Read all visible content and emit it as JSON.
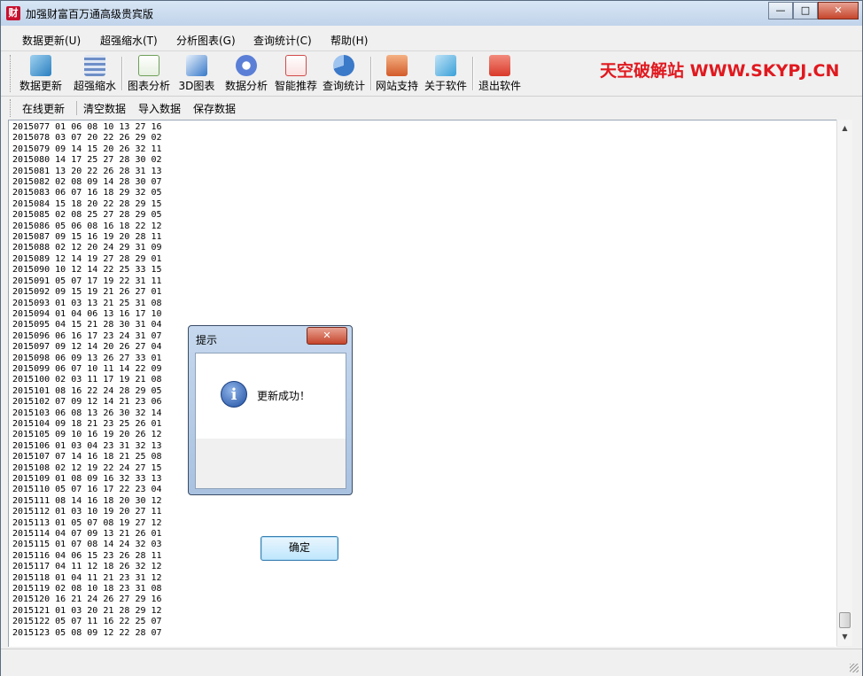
{
  "window": {
    "app_icon_text": "财",
    "title": "加强财富百万通高级贵宾版",
    "min_glyph": "—",
    "max_glyph": "□",
    "close_glyph": "✕"
  },
  "menu": [
    "数据更新(U)",
    "超强缩水(T)",
    "分析图表(G)",
    "查询统计(C)",
    "帮助(H)"
  ],
  "toolbar": [
    {
      "label": "数据更新",
      "icon": "computer-update-icon",
      "color": "#3aa0d8"
    },
    {
      "label": "超强缩水",
      "icon": "shrink-grid-icon",
      "color": "#6d8ec7"
    },
    {
      "label": "图表分析",
      "icon": "chart-doc-icon",
      "color": "#6f9f5a"
    },
    {
      "label": "3D图表",
      "icon": "3d-chart-icon",
      "color": "#3578c9"
    },
    {
      "label": "数据分析",
      "icon": "gear-analysis-icon",
      "color": "#5b7fd6"
    },
    {
      "label": "智能推荐",
      "icon": "recommend-doc-icon",
      "color": "#d24a4a"
    },
    {
      "label": "查询统计",
      "icon": "pie-query-icon",
      "color": "#3b79c9"
    },
    {
      "label": "网站支持",
      "icon": "home-web-icon",
      "color": "#d35b2a"
    },
    {
      "label": "关于软件",
      "icon": "about-computer-icon",
      "color": "#3aa0d8"
    },
    {
      "label": "退出软件",
      "icon": "power-exit-icon",
      "color": "#d93a2a"
    }
  ],
  "brand_text": "天空破解站 WWW.SKYPJ.CN",
  "toolbar2": [
    "在线更新",
    "清空数据",
    "导入数据",
    "保存数据"
  ],
  "rows": [
    "2015077 01 06 08 10 13 27 16",
    "2015078 03 07 20 22 26 29 02",
    "2015079 09 14 15 20 26 32 11",
    "2015080 14 17 25 27 28 30 02",
    "2015081 13 20 22 26 28 31 13",
    "2015082 02 08 09 14 28 30 07",
    "2015083 06 07 16 18 29 32 05",
    "2015084 15 18 20 22 28 29 15",
    "2015085 02 08 25 27 28 29 05",
    "2015086 05 06 08 16 18 22 12",
    "2015087 09 15 16 19 20 28 11",
    "2015088 02 12 20 24 29 31 09",
    "2015089 12 14 19 27 28 29 01",
    "2015090 10 12 14 22 25 33 15",
    "2015091 05 07 17 19 22 31 11",
    "2015092 09 15 19 21 26 27 01",
    "2015093 01 03 13 21 25 31 08",
    "2015094 01 04 06 13 16 17 10",
    "2015095 04 15 21 28 30 31 04",
    "2015096 06 16 17 23 24 31 07",
    "2015097 09 12 14 20 26 27 04",
    "2015098 06 09 13 26 27 33 01",
    "2015099 06 07 10 11 14 22 09",
    "2015100 02 03 11 17 19 21 08",
    "2015101 08 16 22 24 28 29 05",
    "2015102 07 09 12 14 21 23 06",
    "2015103 06 08 13 26 30 32 14",
    "2015104 09 18 21 23 25 26 01",
    "2015105 09 10 16 19 20 26 12",
    "2015106 01 03 04 23 31 32 13",
    "2015107 07 14 16 18 21 25 08",
    "2015108 02 12 19 22 24 27 15",
    "2015109 01 08 09 16 32 33 13",
    "2015110 05 07 16 17 22 23 04",
    "2015111 08 14 16 18 20 30 12",
    "2015112 01 03 10 19 20 27 11",
    "2015113 01 05 07 08 19 27 12",
    "2015114 04 07 09 13 21 26 01",
    "2015115 01 07 08 14 24 32 03",
    "2015116 04 06 15 23 26 28 11",
    "2015117 04 11 12 18 26 32 12",
    "2015118 01 04 11 21 23 31 12",
    "2015119 02 08 10 18 23 31 08",
    "2015120 16 21 24 26 27 29 16",
    "2015121 01 03 20 21 28 29 12",
    "2015122 05 07 11 16 22 25 07",
    "2015123 05 08 09 12 22 28 07"
  ],
  "scrollbar": {
    "up": "▲",
    "down": "▼"
  },
  "dialog": {
    "title": "提示",
    "close_glyph": "✕",
    "icon_glyph": "i",
    "message": "更新成功！",
    "ok_label": "确定"
  }
}
